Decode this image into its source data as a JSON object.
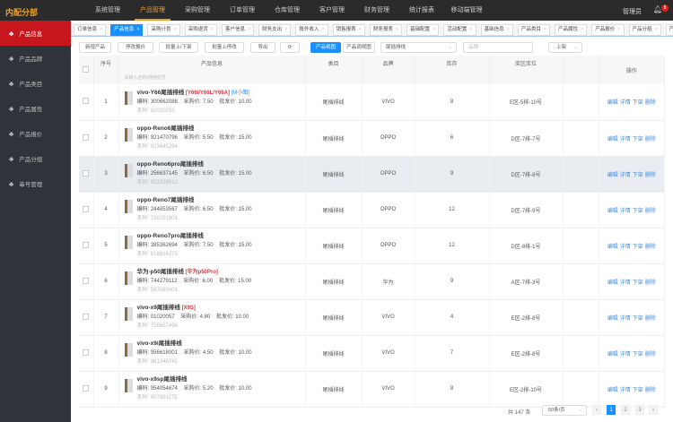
{
  "header": {
    "logo": "内配分部",
    "nav": [
      "系统管理",
      "产品管理",
      "采购管理",
      "订单管理",
      "仓库管理",
      "客户管理",
      "财务管理",
      "统计报表",
      "移动端管理"
    ],
    "active_nav": 1,
    "user": "管理员",
    "notification_count": "8"
  },
  "sidebar": {
    "items": [
      "产品信息",
      "产品品牌",
      "产品类目",
      "产品属性",
      "产品报价",
      "产品分组",
      "串号管理"
    ],
    "active": 0
  },
  "tabs": [
    "订单信息",
    "产品信息",
    "采购计划",
    "采购退货",
    "客户信息",
    "财务支出",
    "账外收入",
    "销售报表",
    "财务报表",
    "基础配置",
    "活动配置",
    "基础信息",
    "产品类目",
    "产品属性",
    "产品报价",
    "产品分组",
    "产品串号"
  ],
  "active_tab": 1,
  "toolbar": {
    "add": "新增产品",
    "price": "停改报价",
    "batch_shelf": "批量上/下架",
    "batch_stop": "批量上停改",
    "export": "导出",
    "refresh": "⟳",
    "view_product": "产品视图",
    "view_batch": "产品调视图",
    "category_select": "尾插排线",
    "brand_placeholder": "品牌",
    "status_select": "上架"
  },
  "table": {
    "headers": {
      "seq": "序号",
      "info": "产品信息",
      "category": "类目",
      "brand": "品牌",
      "stock": "库存",
      "location": "库区库位",
      "ops": "操作"
    },
    "search_placeholder": "请输入名称/通用型号",
    "labels": {
      "code": "编码: ",
      "purchase": "采购价: ",
      "wholesale": "批发价: ",
      "barcode": "条码: "
    },
    "ops": [
      "编辑",
      "详情",
      "下架",
      "删除"
    ],
    "rows": [
      {
        "seq": "1",
        "name": "vivo-Y66尾插排线",
        "tag": "[Y66i/Y66L/Y66A]",
        "tag2": "[M小图]",
        "code": "300662088",
        "purchase": "7.50",
        "wholesale": "10.00",
        "barcode": "01020033",
        "category": "尾插排线",
        "brand": "VIVO",
        "stock": "8",
        "location": "E区-5排-10号"
      },
      {
        "seq": "2",
        "name": "oppo-Reno6尾插排线",
        "tag": "",
        "tag2": "",
        "code": "921470796",
        "purchase": "5.50",
        "wholesale": "15.00",
        "barcode": "823645294",
        "category": "尾插排线",
        "brand": "OPPO",
        "stock": "6",
        "location": "D区-7排-7号"
      },
      {
        "seq": "3",
        "name": "oppo-Reno6pro尾插排线",
        "tag": "",
        "tag2": "",
        "code": "256637145",
        "purchase": "6.50",
        "wholesale": "15.00",
        "barcode": "953338812",
        "category": "尾插排线",
        "brand": "OPPO",
        "stock": "9",
        "location": "D区-7排-8号"
      },
      {
        "seq": "4",
        "name": "oppo-Reno7尾插排线",
        "tag": "",
        "tag2": "",
        "code": "244853567",
        "purchase": "6.50",
        "wholesale": "15.00",
        "barcode": "739291901",
        "category": "尾插排线",
        "brand": "OPPO",
        "stock": "12",
        "location": "D区-7排-9号"
      },
      {
        "seq": "5",
        "name": "oppo-Reno7pro尾插排线",
        "tag": "",
        "tag2": "",
        "code": "385362694",
        "purchase": "7.50",
        "wholesale": "15.00",
        "barcode": "818614273",
        "category": "尾插排线",
        "brand": "OPPO",
        "stock": "12",
        "location": "D区-8排-1号"
      },
      {
        "seq": "6",
        "name": "华为-p50尾插排线",
        "tag": "[华为p50Pro]",
        "tag2": "",
        "code": "744279112",
        "purchase": "6.00",
        "wholesale": "15.00",
        "barcode": "587080401",
        "category": "尾插排线",
        "brand": "华为",
        "stock": "9",
        "location": "A区-7排-3号"
      },
      {
        "seq": "7",
        "name": "vivo-x9尾插排线",
        "tag": "[X9S]",
        "tag2": "",
        "code": "01020057",
        "purchase": "4.80",
        "wholesale": "10.00",
        "barcode": "755657498",
        "category": "尾插排线",
        "brand": "VIVO",
        "stock": "4",
        "location": "E区-2排-8号"
      },
      {
        "seq": "8",
        "name": "vivo-x9i尾插排线",
        "tag": "",
        "tag2": "",
        "code": "956618001",
        "purchase": "4.50",
        "wholesale": "10.00",
        "barcode": "981348745",
        "category": "尾插排线",
        "brand": "VIVO",
        "stock": "7",
        "location": "E区-2排-8号"
      },
      {
        "seq": "9",
        "name": "vivo-x9sp尾插排线",
        "tag": "",
        "tag2": "",
        "code": "954054674",
        "purchase": "5.20",
        "wholesale": "10.00",
        "barcode": "907991175",
        "category": "尾插排线",
        "brand": "VIVO",
        "stock": "8",
        "location": "E区-2排-10号"
      }
    ]
  },
  "pagination": {
    "total": "共 147 条",
    "page_size": "50条/页",
    "pages": [
      "1",
      "2",
      "3"
    ],
    "current": "1",
    "prev": "‹",
    "next": "›"
  }
}
